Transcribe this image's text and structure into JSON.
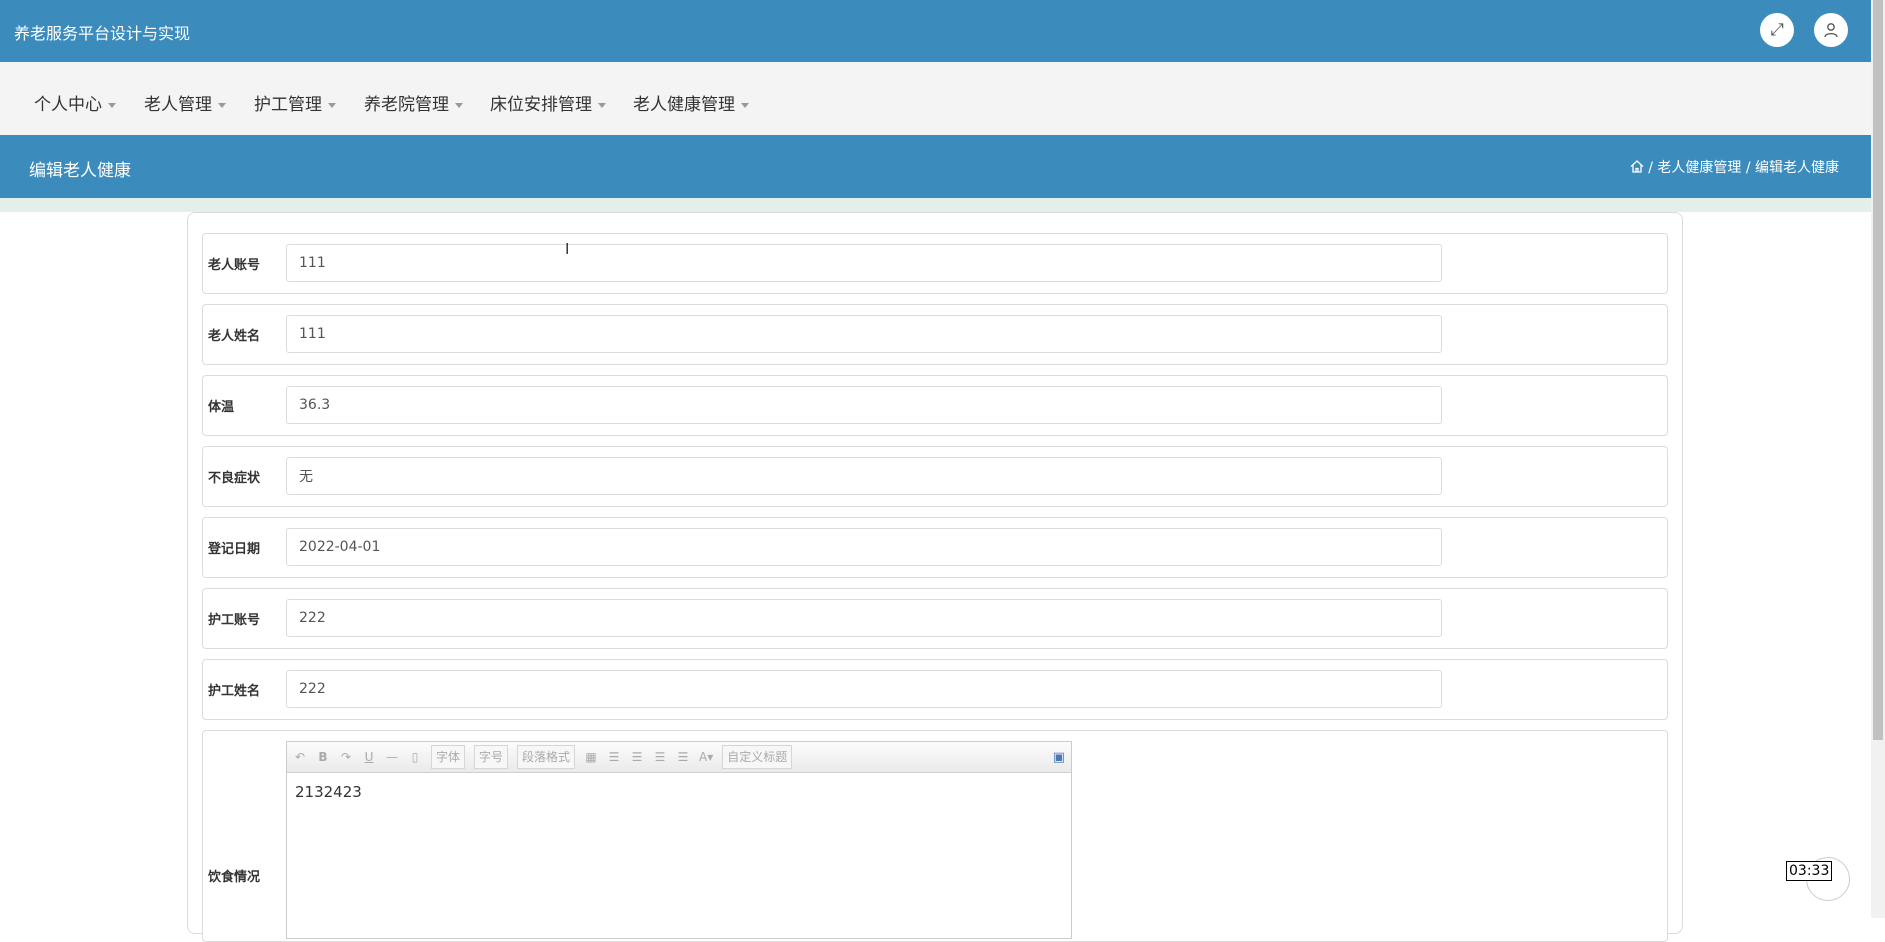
{
  "app": {
    "title": "养老服务平台设计与实现"
  },
  "header_icons": [
    "fullscreen-icon",
    "user-icon"
  ],
  "menu": [
    {
      "label": "个人中心"
    },
    {
      "label": "老人管理"
    },
    {
      "label": "护工管理"
    },
    {
      "label": "养老院管理"
    },
    {
      "label": "床位安排管理"
    },
    {
      "label": "老人健康管理"
    }
  ],
  "page": {
    "title": "编辑老人健康",
    "breadcrumb": {
      "level1": "老人健康管理",
      "level2": "编辑老人健康",
      "separator": "/"
    }
  },
  "form": {
    "fields": [
      {
        "label": "老人账号",
        "value": "111"
      },
      {
        "label": "老人姓名",
        "value": "111"
      },
      {
        "label": "体温",
        "value": "36.3"
      },
      {
        "label": "不良症状",
        "value": "无"
      },
      {
        "label": "登记日期",
        "value": "2022-04-01"
      },
      {
        "label": "护工账号",
        "value": "222"
      },
      {
        "label": "护工姓名",
        "value": "222"
      }
    ],
    "diet": {
      "label": "饮食情况",
      "content": "2132423",
      "toolbar": {
        "font_family": "字体",
        "font_size": "字号",
        "paragraph": "段落格式",
        "custom_title": "自定义标题"
      }
    }
  },
  "overlay": {
    "timer": "03:33"
  },
  "colors": {
    "primary": "#3b8bbd",
    "menu_bg": "#f4f4f4",
    "stripe": "#e4efe9"
  }
}
